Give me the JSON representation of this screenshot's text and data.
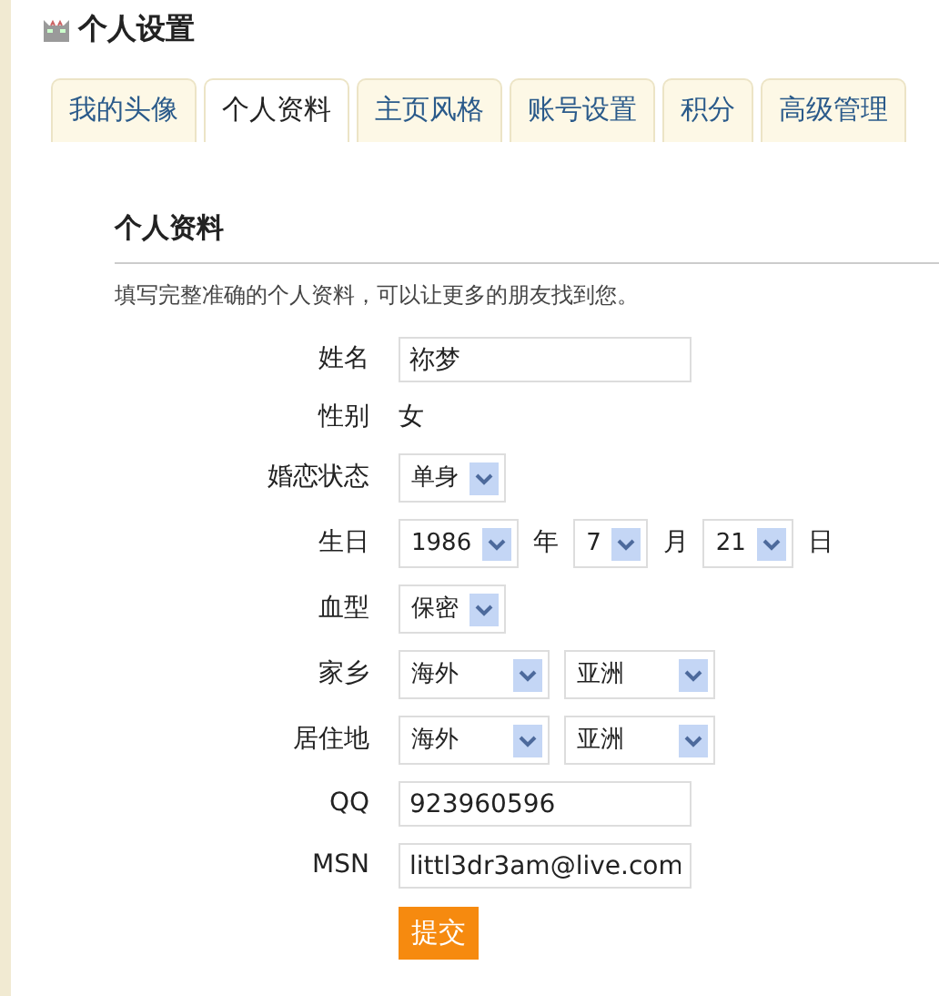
{
  "page_title": "个人设置",
  "tabs": [
    {
      "label": "我的头像",
      "selected": false
    },
    {
      "label": "个人资料",
      "selected": true
    },
    {
      "label": "主页风格",
      "selected": false
    },
    {
      "label": "账号设置",
      "selected": false
    },
    {
      "label": "积分",
      "selected": false
    },
    {
      "label": "高级管理",
      "selected": false
    }
  ],
  "section": {
    "heading": "个人资料",
    "description": "填写完整准确的个人资料，可以让更多的朋友找到您。"
  },
  "fields": [
    {
      "kind": "input",
      "label": "姓名",
      "value": "祢梦"
    },
    {
      "kind": "static",
      "label": "性别",
      "value": "女"
    },
    {
      "kind": "select",
      "label": "婚恋状态",
      "selects": [
        {
          "value": "单身"
        }
      ]
    },
    {
      "kind": "select",
      "label": "生日",
      "selects": [
        {
          "value": "1986",
          "unit": "年"
        },
        {
          "value": "7",
          "unit": "月"
        },
        {
          "value": "21",
          "unit": "日"
        }
      ]
    },
    {
      "kind": "select",
      "label": "血型",
      "selects": [
        {
          "value": "保密"
        }
      ]
    },
    {
      "kind": "select",
      "label": "家乡",
      "selects": [
        {
          "value": "海外"
        },
        {
          "value": "亚洲"
        }
      ]
    },
    {
      "kind": "select",
      "label": "居住地",
      "selects": [
        {
          "value": "海外"
        },
        {
          "value": "亚洲"
        }
      ]
    },
    {
      "kind": "input",
      "label": "QQ",
      "value": "923960596"
    },
    {
      "kind": "input",
      "label": "MSN",
      "value": "littl3dr3am@live.com"
    }
  ],
  "submit": "提交"
}
